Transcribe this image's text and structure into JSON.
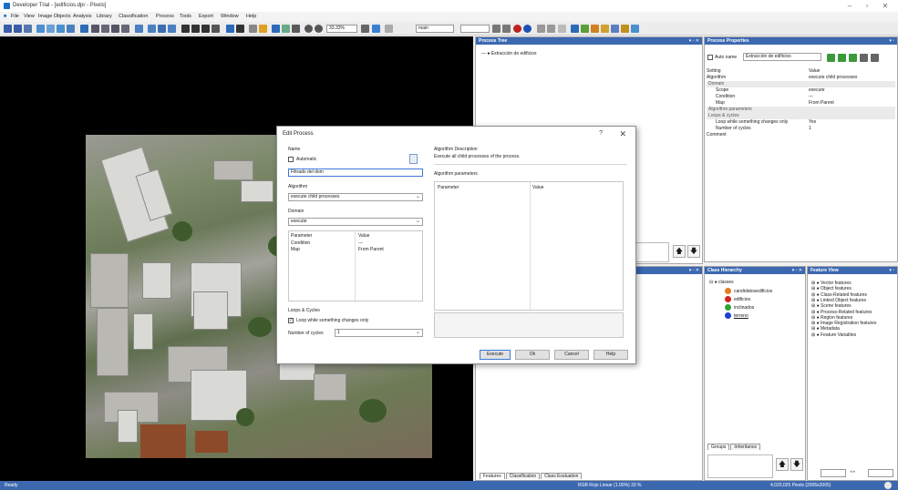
{
  "window": {
    "title": "Developer Trial - [edificios.dpr - Pixels]"
  },
  "menu": [
    "File",
    "View",
    "Image Objects",
    "Analysis",
    "Library",
    "Classification",
    "Process",
    "Tools",
    "Export",
    "Window",
    "Help"
  ],
  "toolbar": {
    "zoom": "33.33%",
    "layer": "main"
  },
  "process_tree": {
    "title": "Process Tree",
    "root_item": "Extracción de edificios"
  },
  "process_properties": {
    "title": "Process Properties",
    "auto_name_label": "Auto name",
    "name_value": "Extracción de edificios",
    "col_setting": "Setting",
    "col_value": "Value",
    "rows": [
      {
        "k": "Algorithm",
        "v": "execute child processes",
        "sec": false
      },
      {
        "k": "Domain",
        "v": "",
        "sec": true
      },
      {
        "k": "Scope",
        "v": "execute",
        "sec": false
      },
      {
        "k": "Condition",
        "v": "---",
        "sec": false
      },
      {
        "k": "Map",
        "v": "From Parent",
        "sec": false
      },
      {
        "k": "Algorithm parameters",
        "v": "",
        "sec": true
      },
      {
        "k": "Loops & cycles",
        "v": "",
        "sec": true
      },
      {
        "k": "Loop while something changes only",
        "v": "Yes",
        "sec": false
      },
      {
        "k": "Number of cycles",
        "v": "1",
        "sec": false
      },
      {
        "k": "Comment",
        "v": "",
        "sec": false
      }
    ]
  },
  "bottom_tabs": [
    "Features",
    "Classification",
    "Class Evaluation"
  ],
  "class_hierarchy": {
    "title": "Class Hierarchy",
    "root": "classes",
    "classes": [
      {
        "name": "candidatosedificios",
        "color": "#e87a1f"
      },
      {
        "name": "edificios",
        "color": "#d42020"
      },
      {
        "name": "inclinados",
        "color": "#2fa52f"
      },
      {
        "name": "terreno",
        "color": "#1f3fd8"
      }
    ],
    "tabs": [
      "Groups",
      "Inheritance"
    ]
  },
  "feature_view": {
    "title": "Feature View",
    "items": [
      "Vector features",
      "Object features",
      "Class-Related features",
      "Linked Object features",
      "Scene features",
      "Process-Related features",
      "Region features",
      "Image Registration features",
      "Metadata",
      "Feature Variables"
    ]
  },
  "dialog": {
    "title": "Edit Process",
    "help": "?",
    "close": "✕",
    "name_label": "Name",
    "automatic_label": "Automatic",
    "name_value": "Filtrado del dom",
    "algorithm_label": "Algorithm",
    "algorithm_value": "execute child processes",
    "domain_label": "Domain",
    "domain_value": "execute",
    "param_col": "Parameter",
    "value_col": "Value",
    "domain_params": [
      {
        "p": "Parameter",
        "v": "Value"
      },
      {
        "p": "Condition",
        "v": "---"
      },
      {
        "p": "Map",
        "v": "From Parent"
      }
    ],
    "loops_label": "Loops & Cycles",
    "loop_label": "Loop while something changes only",
    "cycles_label": "Number of cycles",
    "cycles_value": "1",
    "algo_desc_label": "Algorithm Description",
    "algo_desc_text": "Execute all child processes of the process.",
    "algo_params_label": "Algorithm parameters",
    "buttons": {
      "execute": "Execute",
      "ok": "Ok",
      "cancel": "Cancel",
      "help": "Help"
    }
  },
  "status": {
    "left": "Ready",
    "center": "RGB  Rojo  Linear (1.00%)  33 %",
    "right": "4,020,025 Pixels (2005x2005)"
  }
}
